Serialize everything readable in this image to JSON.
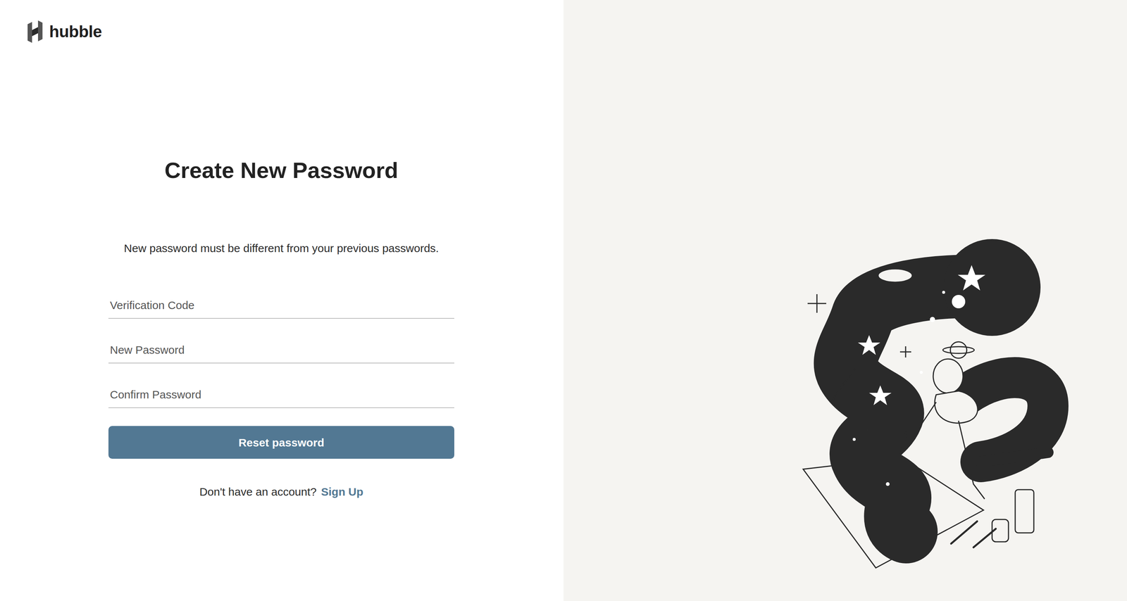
{
  "brand": {
    "name": "hubble"
  },
  "heading": "Create New Password",
  "subtitle": "New password must be different from your previous passwords.",
  "fields": [
    {
      "placeholder": "Verification Code"
    },
    {
      "placeholder": "New Password"
    },
    {
      "placeholder": "Confirm Password"
    }
  ],
  "submit": "Reset password",
  "footer": {
    "text": "Don't have an account?",
    "link": "Sign Up"
  }
}
